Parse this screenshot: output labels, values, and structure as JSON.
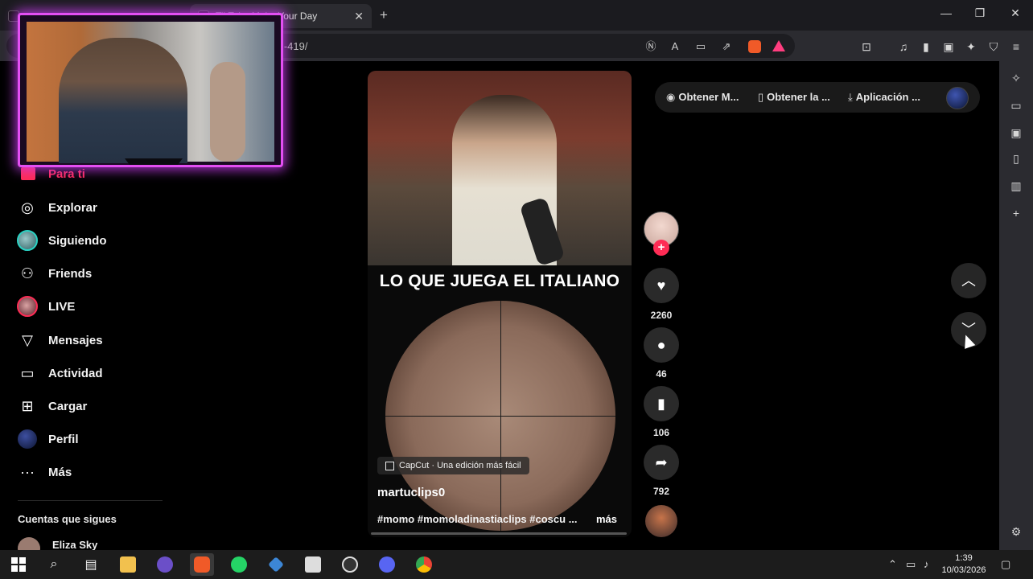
{
  "browser": {
    "tabs": [
      {
        "title": "",
        "active": false
      },
      {
        "title": "TikTok - Make Your Day",
        "active": true
      }
    ],
    "new_tab": "+",
    "window_controls": {
      "minimize": "—",
      "maximize": "❐",
      "close": "✕"
    },
    "url": "...-419/",
    "tab_close": "✕"
  },
  "webcam": {
    "label": "webcam overlay"
  },
  "nav": {
    "para_ti": "Para ti",
    "items": [
      {
        "label": "Explorar",
        "icon": "compass-icon"
      },
      {
        "label": "Siguiendo",
        "icon": "following-avatar"
      },
      {
        "label": "Friends",
        "icon": "friends-icon"
      },
      {
        "label": "LIVE",
        "icon": "live-avatar"
      },
      {
        "label": "Mensajes",
        "icon": "send-icon"
      },
      {
        "label": "Actividad",
        "icon": "activity-icon"
      },
      {
        "label": "Cargar",
        "icon": "upload-icon"
      },
      {
        "label": "Perfil",
        "icon": "profile-avatar"
      },
      {
        "label": "Más",
        "icon": "more-icon"
      }
    ],
    "following_heading": "Cuentas que sigues",
    "following_accounts": [
      {
        "name": "Eliza Sky"
      }
    ]
  },
  "video": {
    "caption": "LO QUE JUEGA EL ITALIANO",
    "capcut": "CapCut · Una edición más fácil",
    "author": "martuclips0",
    "tags": "#momo #momoladinastiaclips #coscu ...",
    "more": "más"
  },
  "actions": {
    "likes": "2260",
    "comments": "46",
    "saves": "106",
    "shares": "792"
  },
  "promo": {
    "item1": "Obtener M...",
    "item2": "Obtener la ...",
    "item3": "Aplicación ..."
  },
  "taskbar": {
    "time": "1:39",
    "date": "10/03/2026"
  },
  "colors": {
    "accent": "#fe2c55",
    "webcam_glow": "#e34ff3",
    "background": "#000000"
  }
}
